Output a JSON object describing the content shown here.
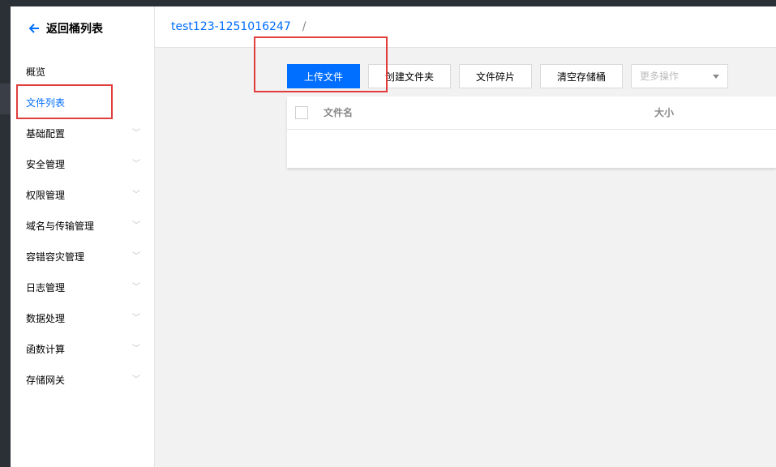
{
  "sidebar": {
    "back_label": "返回桶列表",
    "items": [
      {
        "label": "概览",
        "has_chevron": false
      },
      {
        "label": "文件列表",
        "has_chevron": false,
        "active": true
      },
      {
        "label": "基础配置",
        "has_chevron": true
      },
      {
        "label": "安全管理",
        "has_chevron": true
      },
      {
        "label": "权限管理",
        "has_chevron": true
      },
      {
        "label": "域名与传输管理",
        "has_chevron": true
      },
      {
        "label": "容错容灾管理",
        "has_chevron": true
      },
      {
        "label": "日志管理",
        "has_chevron": true
      },
      {
        "label": "数据处理",
        "has_chevron": true
      },
      {
        "label": "函数计算",
        "has_chevron": true
      },
      {
        "label": "存储网关",
        "has_chevron": true
      }
    ],
    "chevron_icon": "chevron-down-icon"
  },
  "breadcrumb": {
    "bucket": "test123-1251016247",
    "separator": "/"
  },
  "toolbar": {
    "upload": "上传文件",
    "create_folder": "创建文件夹",
    "fragments": "文件碎片",
    "empty_bucket": "清空存储桶",
    "more_actions": "更多操作"
  },
  "table": {
    "columns": [
      "文件名",
      "大小"
    ]
  },
  "colors": {
    "accent": "#006eff",
    "highlight_box": "#e23d3d",
    "dark_frame": "#2b2f36"
  }
}
